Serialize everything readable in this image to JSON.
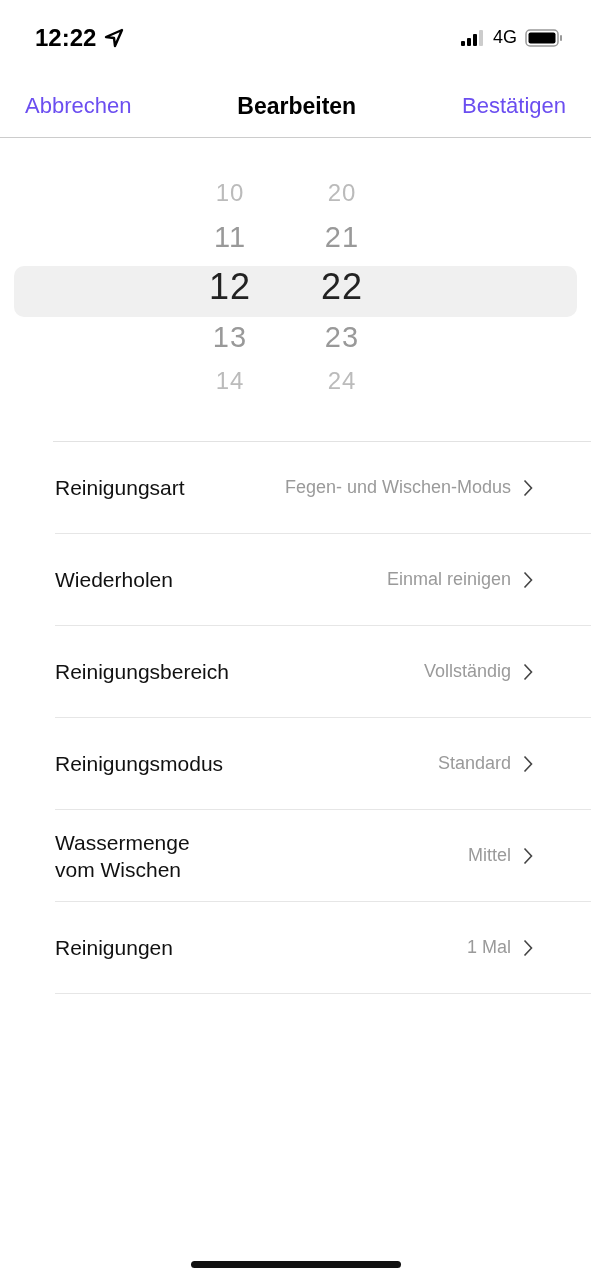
{
  "status_bar": {
    "time": "12:22",
    "network": "4G"
  },
  "nav": {
    "cancel": "Abbrechen",
    "title": "Bearbeiten",
    "confirm": "Bestätigen"
  },
  "picker": {
    "columns": [
      {
        "items": [
          {
            "label": "10",
            "selected": false
          },
          {
            "label": "11",
            "selected": false
          },
          {
            "label": "12",
            "selected": true
          },
          {
            "label": "13",
            "selected": false
          },
          {
            "label": "14",
            "selected": false
          }
        ]
      },
      {
        "items": [
          {
            "label": "20",
            "selected": false
          },
          {
            "label": "21",
            "selected": false
          },
          {
            "label": "22",
            "selected": true
          },
          {
            "label": "23",
            "selected": false
          },
          {
            "label": "24",
            "selected": false
          }
        ]
      }
    ]
  },
  "settings": [
    {
      "label": "Reinigungsart",
      "value": "Fegen- und Wischen-Modus"
    },
    {
      "label": "Wiederholen",
      "value": "Einmal reinigen"
    },
    {
      "label": "Reinigungsbereich",
      "value": "Vollständig"
    },
    {
      "label": "Reinigungsmodus",
      "value": "Standard"
    },
    {
      "label": "Wassermenge\nvom Wischen",
      "value": "Mittel"
    },
    {
      "label": "Reinigungen",
      "value": "1 Mal"
    }
  ]
}
